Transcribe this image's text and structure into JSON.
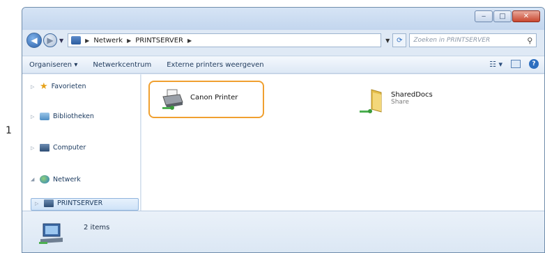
{
  "step_number": "1",
  "address": {
    "segments": [
      "Netwerk",
      "PRINTSERVER"
    ],
    "search_placeholder": "Zoeken in PRINTSERVER"
  },
  "toolbar": {
    "organize": "Organiseren ▾",
    "network_center": "Netwerkcentrum",
    "show_printers": "Externe printers weergeven"
  },
  "sidebar": {
    "favorites": "Favorieten",
    "libraries": "Bibliotheken",
    "computer": "Computer",
    "network": "Netwerk",
    "server": "PRINTSERVER"
  },
  "items": [
    {
      "name": "Canon Printer",
      "subtitle": "",
      "icon": "printer-icon",
      "highlighted": true
    },
    {
      "name": "SharedDocs",
      "subtitle": "Share",
      "icon": "shared-folder-icon",
      "highlighted": false
    }
  ],
  "status": {
    "count_text": "2 items"
  },
  "colors": {
    "highlight": "#f0a030",
    "accent": "#2d6fc0"
  }
}
